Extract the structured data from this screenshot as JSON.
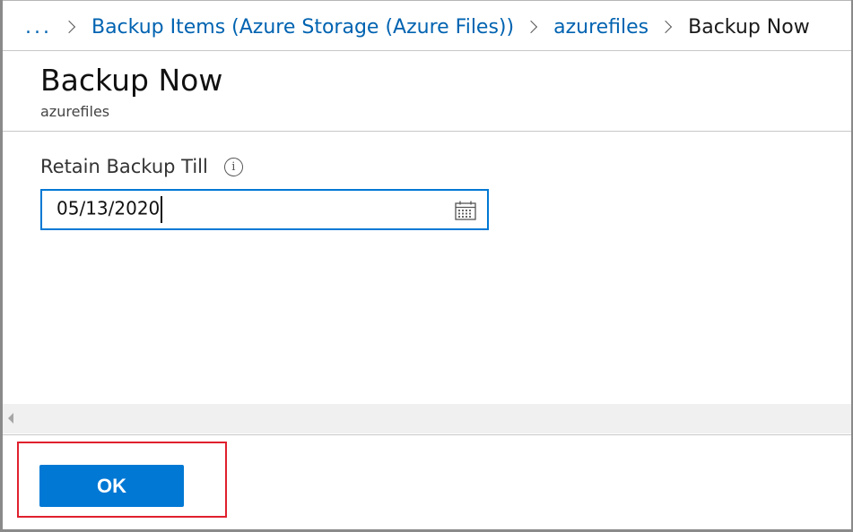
{
  "breadcrumb": {
    "ellipsis": "...",
    "items": [
      {
        "label": "Backup Items (Azure Storage (Azure Files))",
        "link": true
      },
      {
        "label": "azurefiles",
        "link": true
      },
      {
        "label": "Backup Now",
        "link": false
      }
    ]
  },
  "blade": {
    "title": "Backup Now",
    "subtitle": "azurefiles"
  },
  "form": {
    "retain_label": "Retain Backup Till",
    "info_glyph": "i",
    "date_value": "05/13/2020"
  },
  "footer": {
    "ok_label": "OK"
  },
  "colors": {
    "accent": "#0078d4",
    "link": "#0063b1",
    "highlight": "#e0202e"
  },
  "icons": [
    "chevron-right-icon",
    "info-icon",
    "calendar-icon",
    "scroll-left-arrow-icon"
  ]
}
